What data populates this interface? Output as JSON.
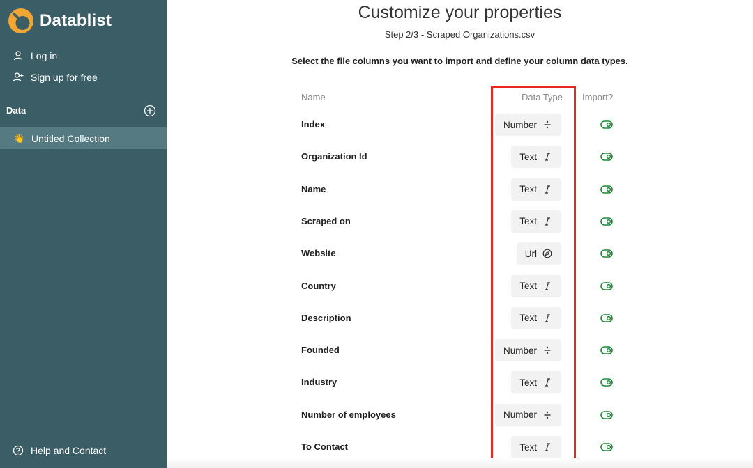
{
  "sidebar": {
    "brand": "Datablist",
    "login": "Log in",
    "signup": "Sign up for free",
    "section": "Data",
    "collection": "Untitled Collection",
    "help": "Help and Contact"
  },
  "header": {
    "title": "Customize your properties",
    "subtitle": "Step 2/3 - Scraped Organizations.csv",
    "instructions": "Select the file columns you want to import and define your column data types."
  },
  "columns": {
    "name": "Name",
    "type": "Data Type",
    "import": "Import?"
  },
  "rows": [
    {
      "name": "Index",
      "type": "Number",
      "icon": "divide-icon",
      "import": true
    },
    {
      "name": "Organization Id",
      "type": "Text",
      "icon": "italic-i-icon",
      "import": true
    },
    {
      "name": "Name",
      "type": "Text",
      "icon": "italic-i-icon",
      "import": true
    },
    {
      "name": "Scraped on",
      "type": "Text",
      "icon": "italic-i-icon",
      "import": true
    },
    {
      "name": "Website",
      "type": "Url",
      "icon": "compass-icon",
      "import": true
    },
    {
      "name": "Country",
      "type": "Text",
      "icon": "italic-i-icon",
      "import": true
    },
    {
      "name": "Description",
      "type": "Text",
      "icon": "italic-i-icon",
      "import": true
    },
    {
      "name": "Founded",
      "type": "Number",
      "icon": "divide-icon",
      "import": true
    },
    {
      "name": "Industry",
      "type": "Text",
      "icon": "italic-i-icon",
      "import": true
    },
    {
      "name": "Number of employees",
      "type": "Number",
      "icon": "divide-icon",
      "import": true
    },
    {
      "name": "To Contact",
      "type": "Text",
      "icon": "italic-i-icon",
      "import": true
    }
  ],
  "colors": {
    "sidebar": "#3b5e66",
    "sidebar_active": "#557a82",
    "toggle_on": "#1f8a3a",
    "highlight": "#e8281e",
    "logo": "#f2a531"
  }
}
